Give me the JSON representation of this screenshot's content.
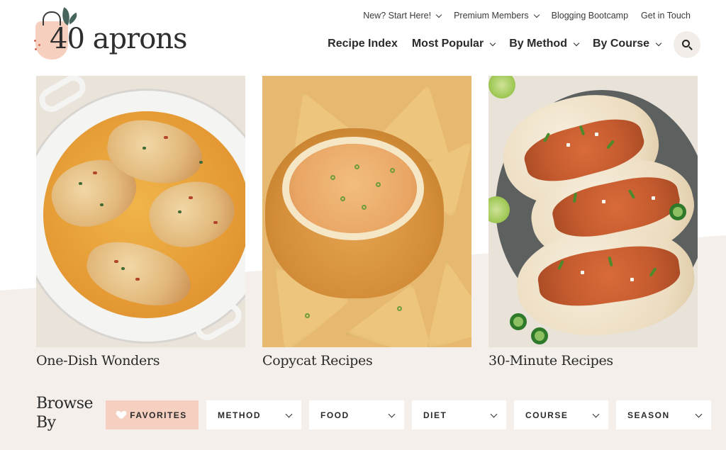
{
  "brand": {
    "logo_text": "40 aprons"
  },
  "top_nav": {
    "items": [
      {
        "label": "New? Start Here!",
        "has_dropdown": true
      },
      {
        "label": "Premium Members",
        "has_dropdown": true
      },
      {
        "label": "Blogging Bootcamp",
        "has_dropdown": false
      },
      {
        "label": "Get in Touch",
        "has_dropdown": false
      }
    ]
  },
  "main_nav": {
    "items": [
      {
        "label": "Recipe Index",
        "has_dropdown": false
      },
      {
        "label": "Most Popular",
        "has_dropdown": true
      },
      {
        "label": "By Method",
        "has_dropdown": true
      },
      {
        "label": "By Course",
        "has_dropdown": true
      }
    ],
    "search_icon": "search-icon"
  },
  "cards": [
    {
      "title": "One-Dish Wonders",
      "image": "skillet-chicken-photo"
    },
    {
      "title": "Copycat Recipes",
      "image": "bread-bowl-queso-photo"
    },
    {
      "title": "30-Minute Recipes",
      "image": "chicken-tacos-photo"
    }
  ],
  "browse": {
    "heading_line1": "Browse",
    "heading_line2": "By",
    "favorites_label": "FAVORITES",
    "filters": [
      {
        "label": "METHOD"
      },
      {
        "label": "FOOD"
      },
      {
        "label": "DIET"
      },
      {
        "label": "COURSE"
      },
      {
        "label": "SEASON"
      }
    ]
  },
  "colors": {
    "favorites_bg": "#f5cfc0",
    "beige_band": "#f4efea",
    "search_bg": "#f2ede8",
    "logo_accent": "#f6cfbf",
    "leaf": "#46635c"
  }
}
